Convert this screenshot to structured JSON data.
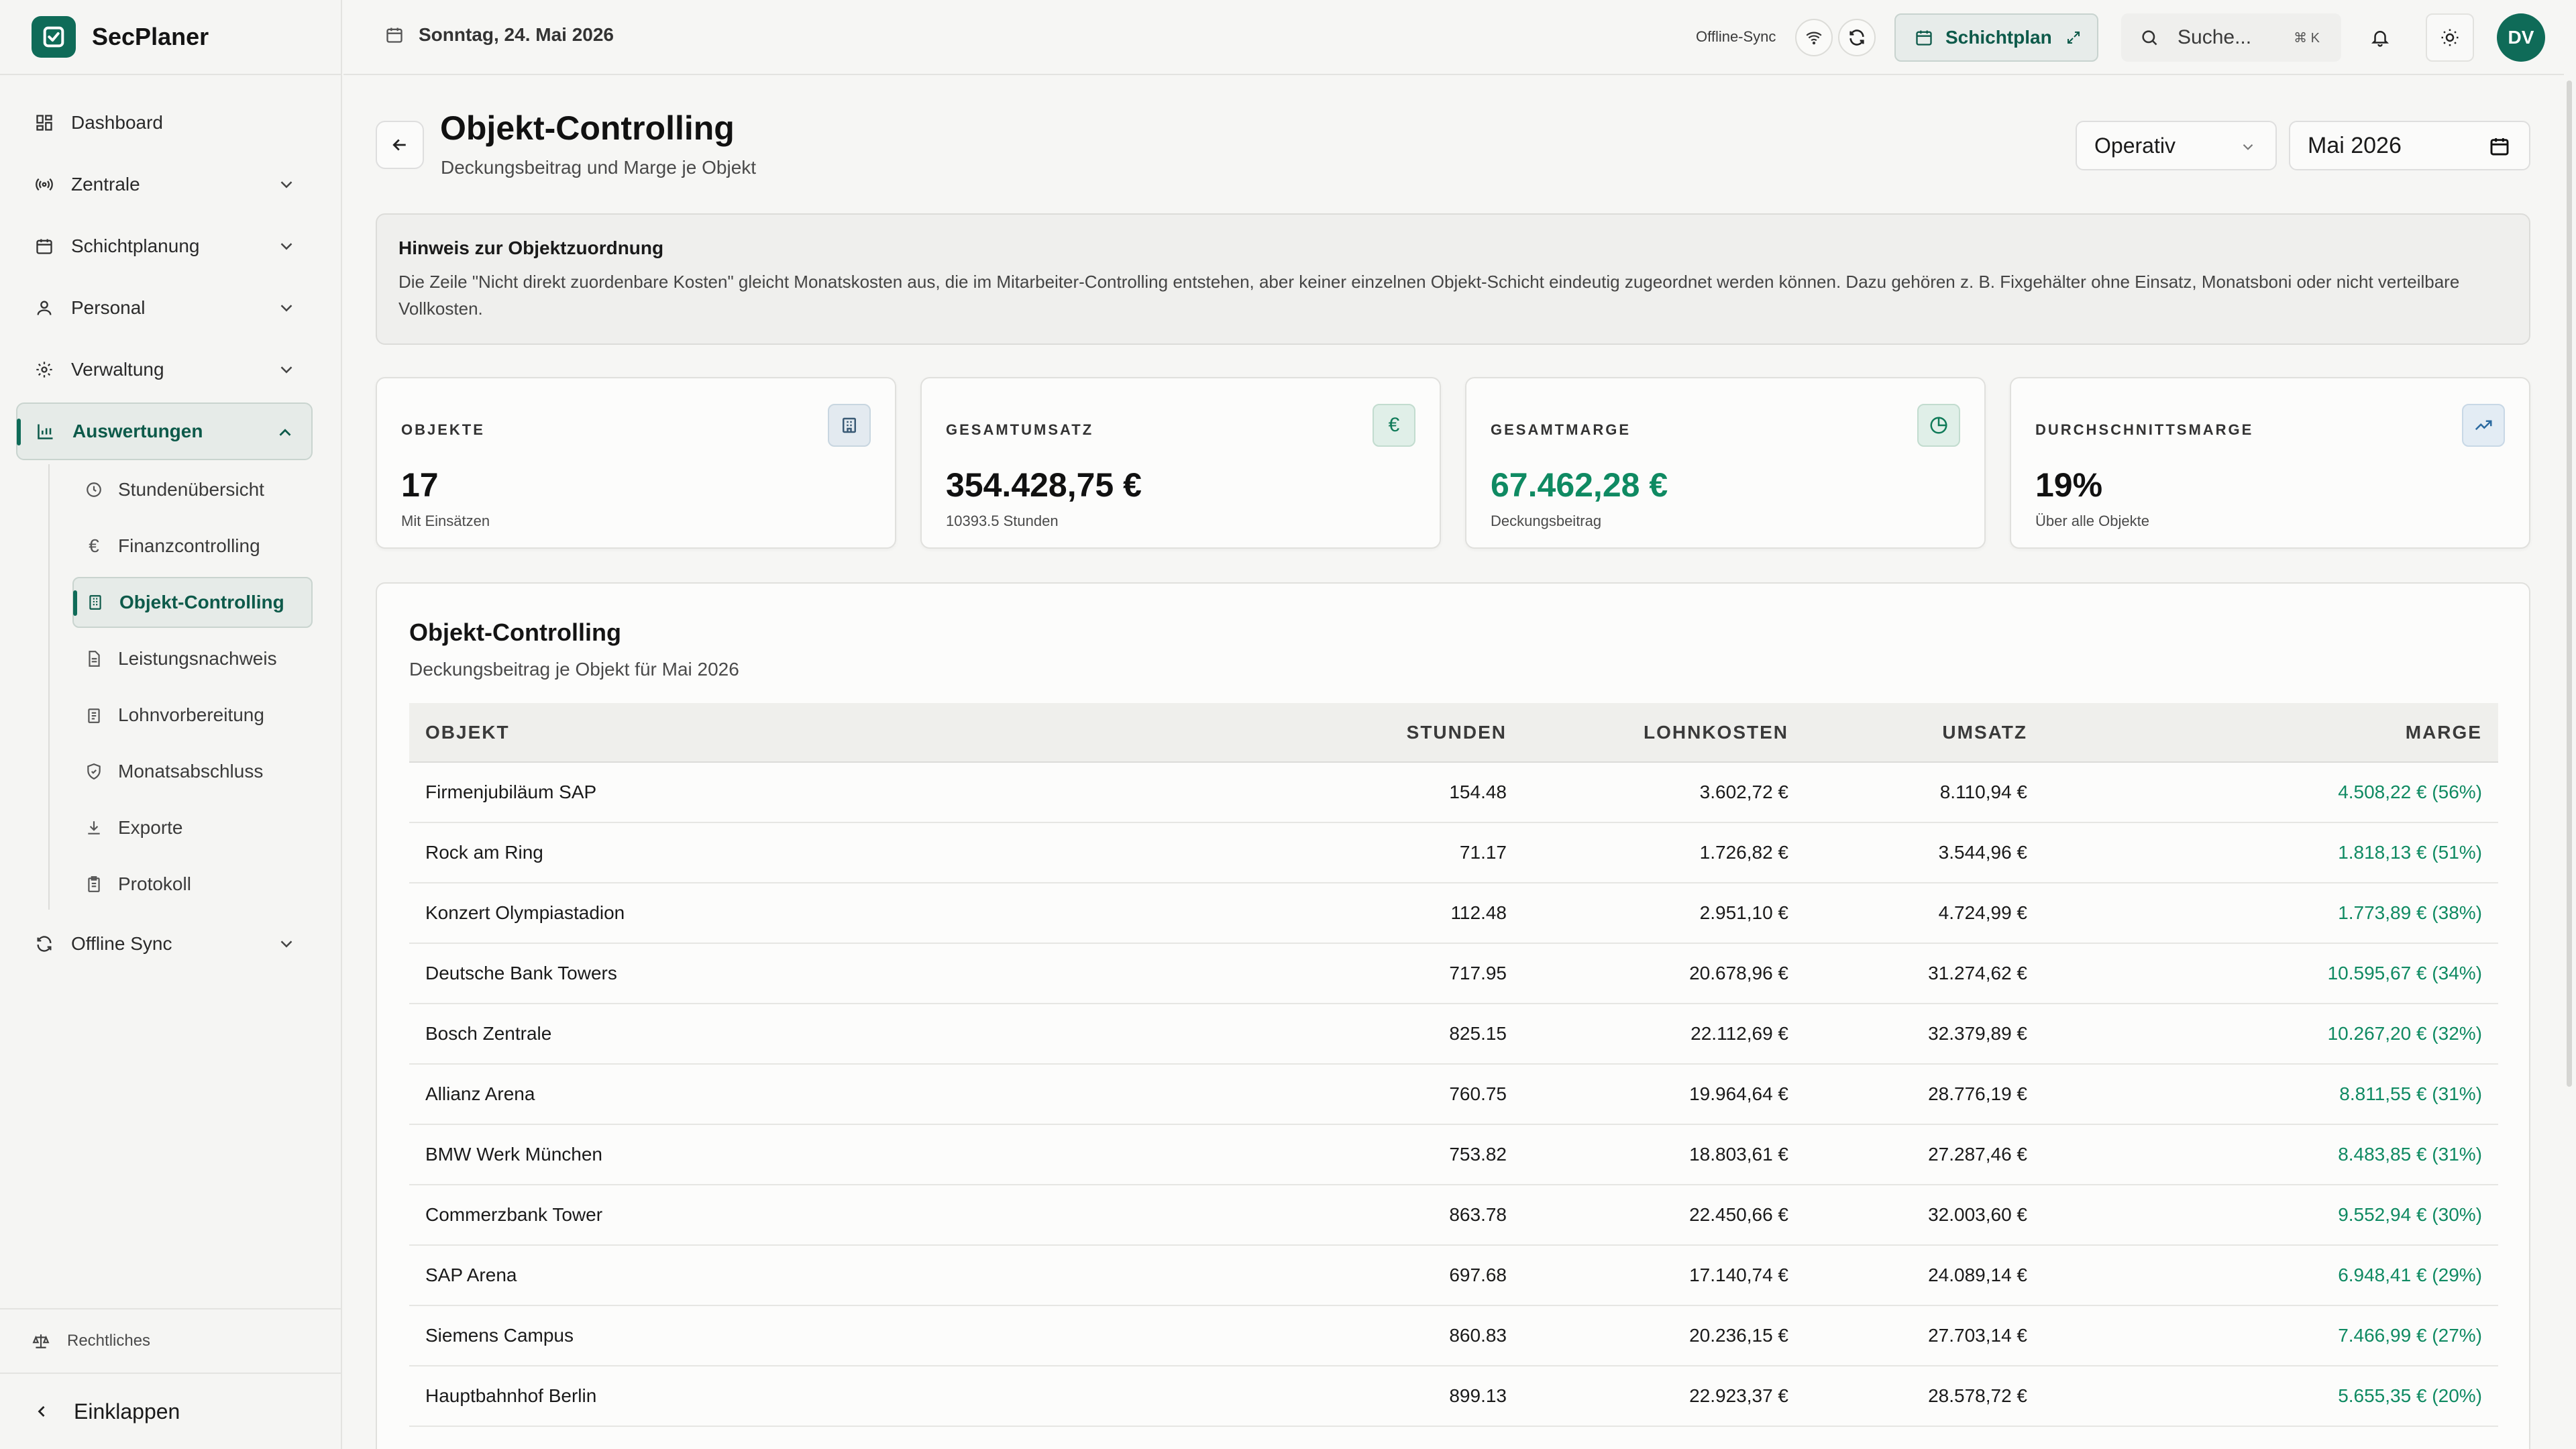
{
  "app": {
    "name": "SecPlaner"
  },
  "sidebar": {
    "items": [
      {
        "label": "Dashboard",
        "icon": "dashboard-icon"
      },
      {
        "label": "Zentrale",
        "icon": "radio-icon"
      },
      {
        "label": "Schichtplanung",
        "icon": "calendar-icon"
      },
      {
        "label": "Personal",
        "icon": "user-icon"
      },
      {
        "label": "Verwaltung",
        "icon": "gear-icon"
      },
      {
        "label": "Auswertungen",
        "icon": "bar-chart-icon"
      }
    ],
    "subitems": [
      {
        "label": "Stundenübersicht",
        "icon": "clock-icon"
      },
      {
        "label": "Finanzcontrolling",
        "icon": "euro-icon"
      },
      {
        "label": "Objekt-Controlling",
        "icon": "building-icon"
      },
      {
        "label": "Leistungsnachweis",
        "icon": "document-icon"
      },
      {
        "label": "Lohnvorbereitung",
        "icon": "clipboard-icon"
      },
      {
        "label": "Monatsabschluss",
        "icon": "shield-check-icon"
      },
      {
        "label": "Exporte",
        "icon": "download-icon"
      },
      {
        "label": "Protokoll",
        "icon": "clipboard-list-icon"
      }
    ],
    "offline_sync": "Offline Sync",
    "legal": "Rechtliches",
    "collapse": "Einklappen"
  },
  "topbar": {
    "date": "Sonntag, 24. Mai 2026",
    "sync_label": "Offline-Sync",
    "plan_button": "Schichtplan",
    "search_placeholder": "Suche...",
    "search_shortcut": "⌘ K",
    "avatar_initials": "DV"
  },
  "page": {
    "title": "Objekt-Controlling",
    "subtitle": "Deckungsbeitrag und Marge je Objekt",
    "mode_select": "Operativ",
    "month": "Mai 2026"
  },
  "notice": {
    "title": "Hinweis zur Objektzuordnung",
    "text": "Die Zeile \"Nicht direkt zuordenbare Kosten\" gleicht Monatskosten aus, die im Mitarbeiter-Controlling entstehen, aber keiner einzelnen Objekt-Schicht eindeutig zugeordnet werden können. Dazu gehören z. B. Fixgehälter ohne Einsatz, Monatsboni oder nicht verteilbare Vollkosten."
  },
  "kpis": [
    {
      "label": "OBJEKTE",
      "value": "17",
      "sub": "Mit Einsätzen",
      "icon": "building-icon"
    },
    {
      "label": "GESAMTUMSATZ",
      "value": "354.428,75 €",
      "sub": "10393.5 Stunden",
      "icon": "euro-icon"
    },
    {
      "label": "GESAMTMARGE",
      "value": "67.462,28 €",
      "sub": "Deckungsbeitrag",
      "icon": "pie-chart-icon"
    },
    {
      "label": "DURCHSCHNITTSMARGE",
      "value": "19%",
      "sub": "Über alle Objekte",
      "icon": "trending-up-icon"
    }
  ],
  "table": {
    "title": "Objekt-Controlling",
    "subtitle": "Deckungsbeitrag je Objekt für Mai 2026",
    "columns": [
      "OBJEKT",
      "STUNDEN",
      "LOHNKOSTEN",
      "UMSATZ",
      "MARGE"
    ],
    "rows": [
      [
        "Firmenjubiläum SAP",
        "154.48",
        "3.602,72 €",
        "8.110,94 €",
        "4.508,22 € (56%)"
      ],
      [
        "Rock am Ring",
        "71.17",
        "1.726,82 €",
        "3.544,96 €",
        "1.818,13 € (51%)"
      ],
      [
        "Konzert Olympiastadion",
        "112.48",
        "2.951,10 €",
        "4.724,99 €",
        "1.773,89 € (38%)"
      ],
      [
        "Deutsche Bank Towers",
        "717.95",
        "20.678,96 €",
        "31.274,62 €",
        "10.595,67 € (34%)"
      ],
      [
        "Bosch Zentrale",
        "825.15",
        "22.112,69 €",
        "32.379,89 €",
        "10.267,20 € (32%)"
      ],
      [
        "Allianz Arena",
        "760.75",
        "19.964,64 €",
        "28.776,19 €",
        "8.811,55 € (31%)"
      ],
      [
        "BMW Werk München",
        "753.82",
        "18.803,61 €",
        "27.287,46 €",
        "8.483,85 € (31%)"
      ],
      [
        "Commerzbank Tower",
        "863.78",
        "22.450,66 €",
        "32.003,60 €",
        "9.552,94 € (30%)"
      ],
      [
        "SAP Arena",
        "697.68",
        "17.140,74 €",
        "24.089,14 €",
        "6.948,41 € (29%)"
      ],
      [
        "Siemens Campus",
        "860.83",
        "20.236,15 €",
        "27.703,14 €",
        "7.466,99 € (27%)"
      ],
      [
        "Hauptbahnhof Berlin",
        "899.13",
        "22.923,37 €",
        "28.578,72 €",
        "5.655,35 € (20%)"
      ]
    ]
  },
  "colors": {
    "accent": "#0f6b58",
    "positive": "#0f8a62"
  }
}
